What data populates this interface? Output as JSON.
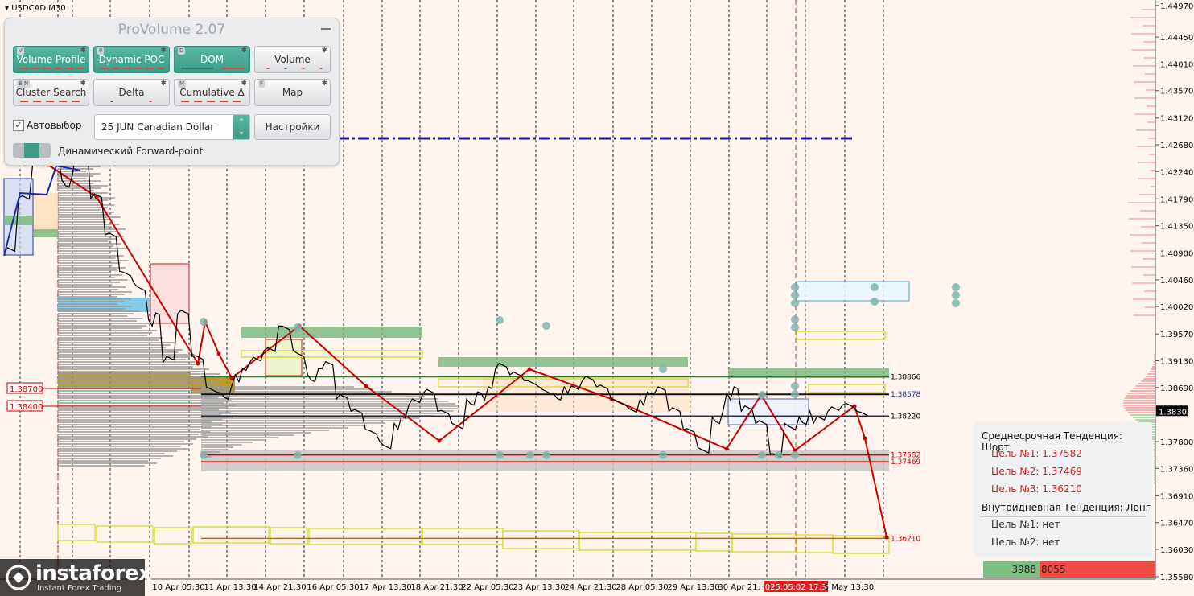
{
  "symbol": "USDCAD,M30",
  "price_axis": [
    "1.44970",
    "1.44450",
    "1.44010",
    "1.43570",
    "1.43120",
    "1.42680",
    "1.42240",
    "1.41790",
    "1.41350",
    "1.40900",
    "1.40460",
    "1.40020",
    "1.39570",
    "1.39130",
    "1.38690",
    "1.38302",
    "1.37800",
    "1.37360",
    "1.36910",
    "1.36470",
    "1.36030",
    "1.35580"
  ],
  "current_price": "1.38302",
  "time_axis": [
    "10 Apr 05:30",
    "11 Apr 13:30",
    "14 Apr 21:30",
    "16 Apr 05:30",
    "17 Apr 13:30",
    "18 Apr 21:30",
    "22 Apr 05:30",
    "23 Apr 13:30",
    "24 Apr 21:30",
    "28 Apr 05:30",
    "29 Apr 13:30",
    "30 Apr 21:30",
    "2025.05.02 17:30",
    "5 May 13:30"
  ],
  "left_labels": [
    "1.38700",
    "1.38400"
  ],
  "level_labels": [
    "1.38866",
    "1.38578",
    "1.38220",
    "1.37582",
    "1.37469",
    "1.36210"
  ],
  "panel": {
    "title": "ProVolume 2.07",
    "buttons": [
      {
        "key": "V",
        "label": "Volume Profile",
        "on": true
      },
      {
        "key": "P",
        "label": "Dynamic POC",
        "on": true
      },
      {
        "key": "D",
        "label": "DOM",
        "on": true
      },
      {
        "key": "",
        "label": "Volume",
        "on": false
      },
      {
        "key": "B N",
        "label": "Cluster Search",
        "on": false
      },
      {
        "key": "",
        "label": "Delta",
        "on": false
      },
      {
        "key": "M",
        "label": "Cumulative Δ",
        "on": false
      },
      {
        "key": "F",
        "label": "Map",
        "on": false
      }
    ],
    "auto_label": "Автовыбор",
    "instrument": "25 JUN Canadian Dollar",
    "settings_label": "Настройки",
    "forward_label": "Динамический Forward-point"
  },
  "trend_box": {
    "mid_title": "Среднесрочная Тенденция: Шорт",
    "mid_targets": [
      "Цель №1: 1.37582",
      "Цель №2: 1.37469",
      "Цель №3: 1.36210"
    ],
    "intra_title": "Внутридневная Тенденция: Лонг",
    "intra_targets": [
      "Цель №1: нет",
      "Цель №2: нет"
    ]
  },
  "volume_bar": {
    "buy": "3988",
    "sell": "8055"
  },
  "brand": {
    "name": "instaforex",
    "tagline": "Instant Forex Trading"
  },
  "colors": {
    "up_zone": "#77b77a",
    "down_zone": "#e7443d",
    "poc": "#d6d617",
    "price": "#000000",
    "trend_line": "#cc0000",
    "dash_blue": "#1b1b8f"
  },
  "chart_data": {
    "type": "line",
    "title": "USDCAD,M30",
    "ylim": [
      1.3554,
      1.4506
    ],
    "y_ticks": [
      1.4497,
      1.4445,
      1.4401,
      1.4357,
      1.4312,
      1.4268,
      1.4224,
      1.4179,
      1.4135,
      1.409,
      1.4046,
      1.4002,
      1.3957,
      1.3913,
      1.3869,
      1.383,
      1.378,
      1.3736,
      1.3691,
      1.3647,
      1.3603,
      1.3558
    ],
    "series": [
      {
        "values": [
          1.409,
          1.418,
          1.424,
          1.426,
          1.421,
          1.426,
          1.418,
          1.412,
          1.406,
          1.404,
          1.398,
          1.391,
          1.399,
          1.392,
          1.387,
          1.386,
          1.389,
          1.391,
          1.393,
          1.397,
          1.393,
          1.389,
          1.39,
          1.385,
          1.383,
          1.38,
          1.378,
          1.381,
          1.384,
          1.386,
          1.383,
          1.381,
          1.385,
          1.386,
          1.39,
          1.389,
          1.388,
          1.387,
          1.386,
          1.386,
          1.388,
          1.387,
          1.385,
          1.384,
          1.385,
          1.386,
          1.383,
          1.38,
          1.377,
          1.382,
          1.386,
          1.383,
          1.381,
          1.376,
          1.381,
          1.382,
          1.381,
          1.383,
          1.384,
          1.383
        ]
      }
    ],
    "levels": [
      {
        "label": "1.38866",
        "value": 1.38866
      },
      {
        "label": "1.38578",
        "value": 1.38578
      },
      {
        "label": "1.38220",
        "value": 1.3822
      },
      {
        "label": "1.37582",
        "value": 1.37582
      },
      {
        "label": "1.37469",
        "value": 1.37469
      },
      {
        "label": "1.36210",
        "value": 1.3621
      }
    ]
  }
}
